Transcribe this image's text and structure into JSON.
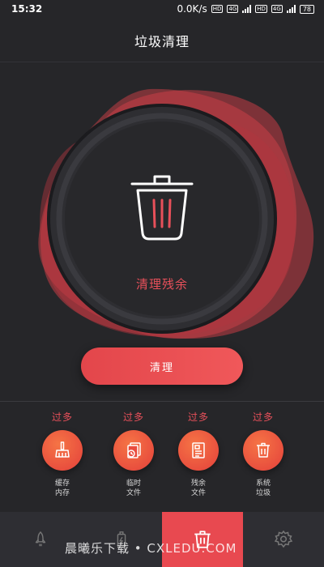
{
  "status_bar": {
    "time": "15:32",
    "speed": "0.0K/s",
    "net1": "4G",
    "net2": "4G",
    "battery": "78"
  },
  "header": {
    "title": "垃圾清理"
  },
  "hero": {
    "label": "清理残余"
  },
  "clean_button": {
    "label": "清理"
  },
  "categories": [
    {
      "badge": "过多",
      "line1": "缓存",
      "line2": "内存",
      "icon": "broom-icon"
    },
    {
      "badge": "过多",
      "line1": "临时",
      "line2": "文件",
      "icon": "files-icon"
    },
    {
      "badge": "过多",
      "line1": "残余",
      "line2": "文件",
      "icon": "document-icon"
    },
    {
      "badge": "过多",
      "line1": "系统",
      "line2": "垃圾",
      "icon": "trash-icon"
    }
  ],
  "nav": {
    "active_index": 2,
    "items": [
      "rocket-icon",
      "battery-icon",
      "trash-icon",
      "gear-icon"
    ]
  },
  "watermark": "晨曦乐下载 • CXLEDU.COM",
  "colors": {
    "background": "#262629",
    "accent": "#e84950",
    "category_circle": "#f06040"
  }
}
